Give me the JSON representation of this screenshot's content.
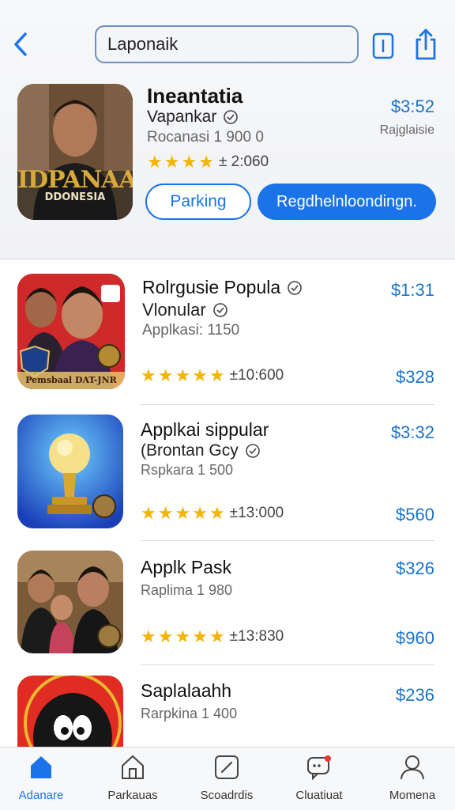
{
  "search": {
    "value": "Laponaik"
  },
  "featured": {
    "title": "Ineantatia",
    "subtitle": "Vapankar",
    "meta": "Rocanasi 1 900 0",
    "rating_stars": 4,
    "rating_text": "± 2:060",
    "price": "$3:52",
    "price_note": "Rajglaisie",
    "icon_text_main": "IDPANAA",
    "icon_text_sub": "DDONESIA",
    "button_outline": "Parking",
    "button_primary": "Regdhelnloondingn."
  },
  "list": [
    {
      "title": "Rolrgusie Popula",
      "subtitle": "Vlonular",
      "meta": "Applkasi: 1150",
      "rating_stars": 5,
      "rating_text": "±10:600",
      "price_top": "$1:31",
      "price_bottom": "$328",
      "icon_caption": "Pemsbaal DAT-JNR"
    },
    {
      "title": "Applkai sippular",
      "subtitle": "(Brontan Gcy",
      "meta": "Rspkara 1 500",
      "rating_stars": 5,
      "rating_text": "±13:000",
      "price_top": "$3:32",
      "price_bottom": "$560",
      "icon_caption": ""
    },
    {
      "title": "Applk Pask",
      "subtitle": "",
      "meta": "Raplima 1 980",
      "rating_stars": 5,
      "rating_text": "±13:830",
      "price_top": "$326",
      "price_bottom": "$960",
      "icon_caption": ""
    },
    {
      "title": "Saplalaahh",
      "subtitle": "",
      "meta": "Rarpkina 1 400",
      "price_top": "$236",
      "icon_caption": ""
    }
  ],
  "tabs": [
    {
      "label": "Adanare",
      "icon": "home-icon",
      "active": true
    },
    {
      "label": "Parkauas",
      "icon": "house-outline-icon",
      "active": false
    },
    {
      "label": "Scoadrdis",
      "icon": "edit-square-icon",
      "active": false
    },
    {
      "label": "Cluatiuat",
      "icon": "chat-icon",
      "active": false
    },
    {
      "label": "Momena",
      "icon": "person-icon",
      "active": false
    }
  ],
  "colors": {
    "accent": "#1a73e8",
    "price": "#1a73c9",
    "star": "#f4b400"
  }
}
